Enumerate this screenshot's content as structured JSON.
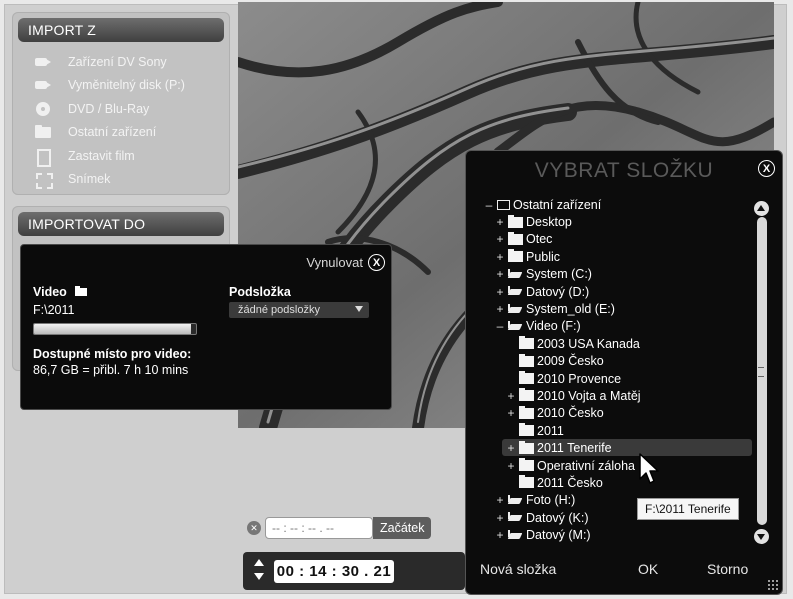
{
  "import_from": {
    "title": "IMPORT Z",
    "items": [
      {
        "label": "Zařízení DV Sony",
        "icon": "camera-icon"
      },
      {
        "label": "Vyměnitelný disk (P:)",
        "icon": "camera-icon"
      },
      {
        "label": "DVD / Blu-Ray",
        "icon": "disc-icon"
      },
      {
        "label": "Ostatní zařízení",
        "icon": "folder-icon"
      },
      {
        "label": "Zastavit film",
        "icon": "film-icon"
      },
      {
        "label": "Snímek",
        "icon": "frame-icon"
      }
    ]
  },
  "import_to": {
    "title": "IMPORTOVAT DO",
    "reset_label": "Vynulovat",
    "video_label": "Video",
    "video_path": "F:\\2011",
    "space_fraction": 0.97,
    "space_label": "Dostupné místo pro video:",
    "space_value": "86,7 GB = přibl. 7 h 10 mins",
    "subfolder_label": "Podsložka",
    "subfolder_value": "žádné podsložky"
  },
  "folder_dialog": {
    "title": "VYBRAT SLOŽKU",
    "tree": [
      {
        "toggle": "–",
        "icon": "monitor",
        "label": "Ostatní zařízení",
        "level": 0
      },
      {
        "toggle": "+",
        "icon": "folder",
        "label": "Desktop",
        "level": 1
      },
      {
        "toggle": "+",
        "icon": "folder",
        "label": "Otec",
        "level": 1
      },
      {
        "toggle": "+",
        "icon": "folder",
        "label": "Public",
        "level": 1
      },
      {
        "toggle": "+",
        "icon": "drive",
        "label": "System (C:)",
        "level": 1
      },
      {
        "toggle": "+",
        "icon": "drive",
        "label": "Datový (D:)",
        "level": 1
      },
      {
        "toggle": "+",
        "icon": "drive",
        "label": "System_old (E:)",
        "level": 1
      },
      {
        "toggle": "–",
        "icon": "drive",
        "label": "Video (F:)",
        "level": 1
      },
      {
        "toggle": "",
        "icon": "folder",
        "label": "2003 USA Kanada",
        "level": 2
      },
      {
        "toggle": "",
        "icon": "folder",
        "label": "2009 Česko",
        "level": 2
      },
      {
        "toggle": "",
        "icon": "folder",
        "label": "2010 Provence",
        "level": 2
      },
      {
        "toggle": "+",
        "icon": "folder",
        "label": "2010 Vojta a Matěj",
        "level": 2
      },
      {
        "toggle": "+",
        "icon": "folder",
        "label": "2010 Česko",
        "level": 2
      },
      {
        "toggle": "",
        "icon": "folder",
        "label": "2011",
        "level": 2
      },
      {
        "toggle": "+",
        "icon": "folder",
        "label": "2011 Tenerife",
        "level": 2,
        "selected": true
      },
      {
        "toggle": "+",
        "icon": "folder",
        "label": "Operativní záloha",
        "level": 2
      },
      {
        "toggle": "",
        "icon": "folder",
        "label": "2011 Česko",
        "level": 2
      },
      {
        "toggle": "+",
        "icon": "drive",
        "label": "Foto (H:)",
        "level": 1
      },
      {
        "toggle": "+",
        "icon": "drive",
        "label": "Datový (K:)",
        "level": 1
      },
      {
        "toggle": "+",
        "icon": "drive",
        "label": "Datový (M:)",
        "level": 1
      }
    ],
    "tooltip": "F:\\2011 Tenerife",
    "new_folder_label": "Nová složka",
    "ok_label": "OK",
    "cancel_label": "Storno"
  },
  "timecode": {
    "start_value": "-- : -- : -- . --",
    "start_label": "Začátek",
    "current": "00 : 14 : 30 . 21"
  },
  "colors": {
    "panel_bg": "#c2c2c2",
    "dialog_bg": "#0c0c0c",
    "panel_header": "#4a4a4a"
  }
}
